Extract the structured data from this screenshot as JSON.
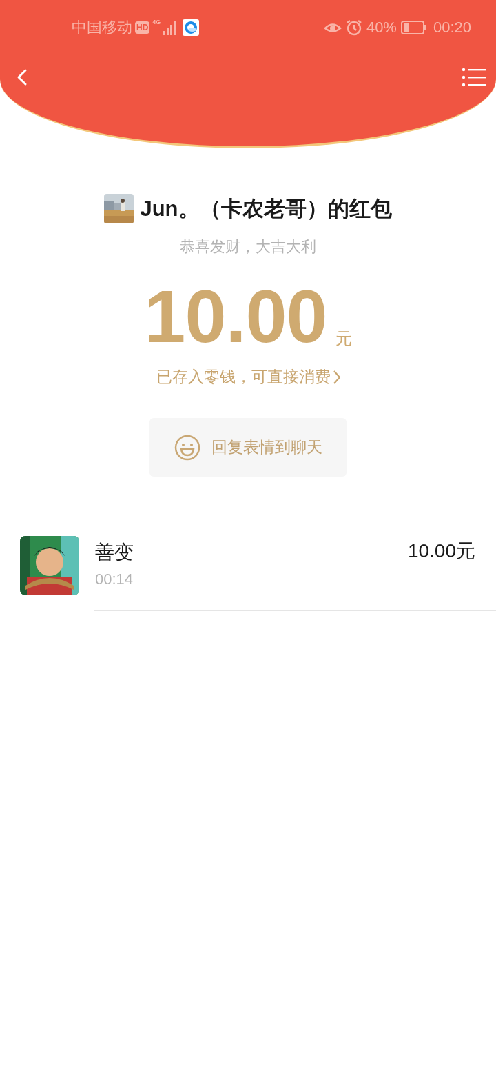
{
  "status_bar": {
    "carrier": "中国移动",
    "hd_badge": "HD",
    "network": "4G",
    "battery": "40%",
    "time": "00:20"
  },
  "packet": {
    "title": "Jun。（卡农老哥）的红包",
    "blessing": "恭喜发财，大吉大利",
    "amount": "10.00",
    "currency": "元",
    "note": "已存入零钱，可直接消费",
    "reply_button": "回复表情到聊天"
  },
  "receivers": [
    {
      "name": "善变",
      "time": "00:14",
      "amount": "10.00元"
    }
  ]
}
